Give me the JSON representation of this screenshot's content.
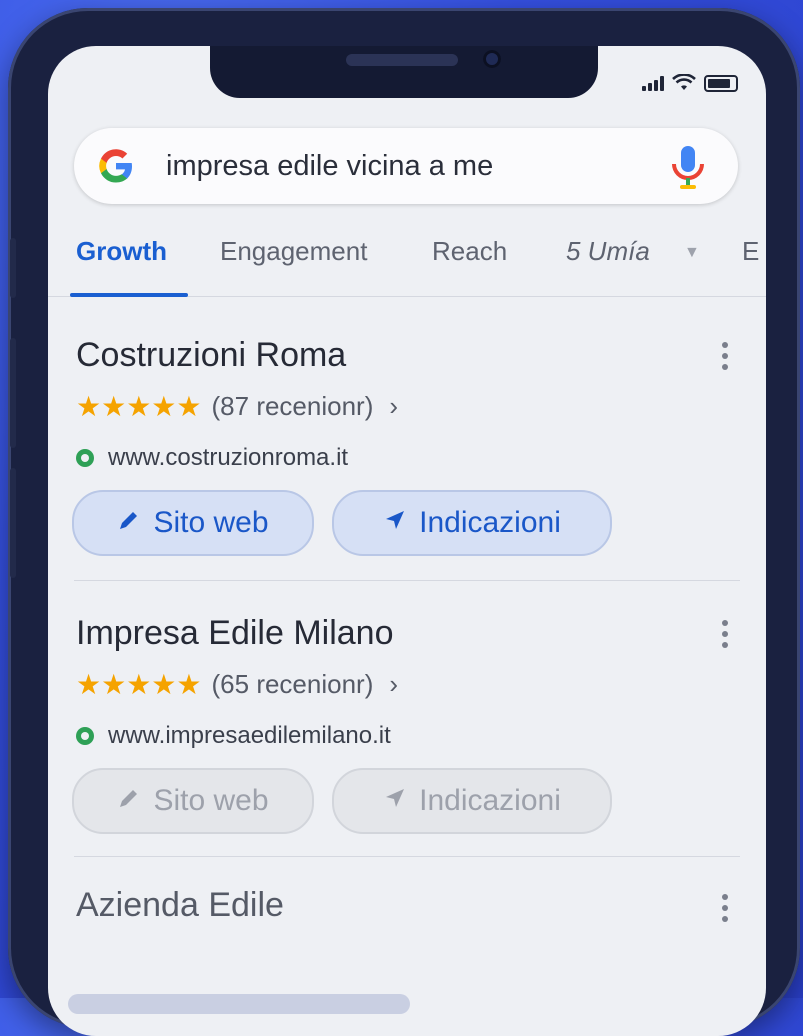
{
  "status_bar": {
    "signal": "signal-icon",
    "wifi": "wifi-icon",
    "battery": "battery-icon"
  },
  "search": {
    "query": "impresa edile vicina a me"
  },
  "tabs": [
    {
      "label": "Growth",
      "active": true
    },
    {
      "label": "Engagement"
    },
    {
      "label": "Reach"
    },
    {
      "label": "5  Umía",
      "has_dropdown": true
    },
    {
      "label": "E"
    }
  ],
  "results": [
    {
      "title": "Costruzioni Roma",
      "stars": "★★★★★",
      "reviews": "(87  recenionr)",
      "url": "www.costruzionroma.it",
      "website_label": "Sito web",
      "directions_label": "Indicazioni"
    },
    {
      "title": "Impresa Edile Milano",
      "stars": "★★★★★",
      "reviews": "(65  recenionr)",
      "url": "www.impresaedilemilano.it",
      "website_label": "Sito web",
      "directions_label": "Indicazioni"
    },
    {
      "title": "Azienda Edile"
    }
  ],
  "colors": {
    "accent": "#1a5fd1",
    "stars": "#f5a300",
    "url_dot": "#2ea056",
    "background": "#3550e0"
  }
}
